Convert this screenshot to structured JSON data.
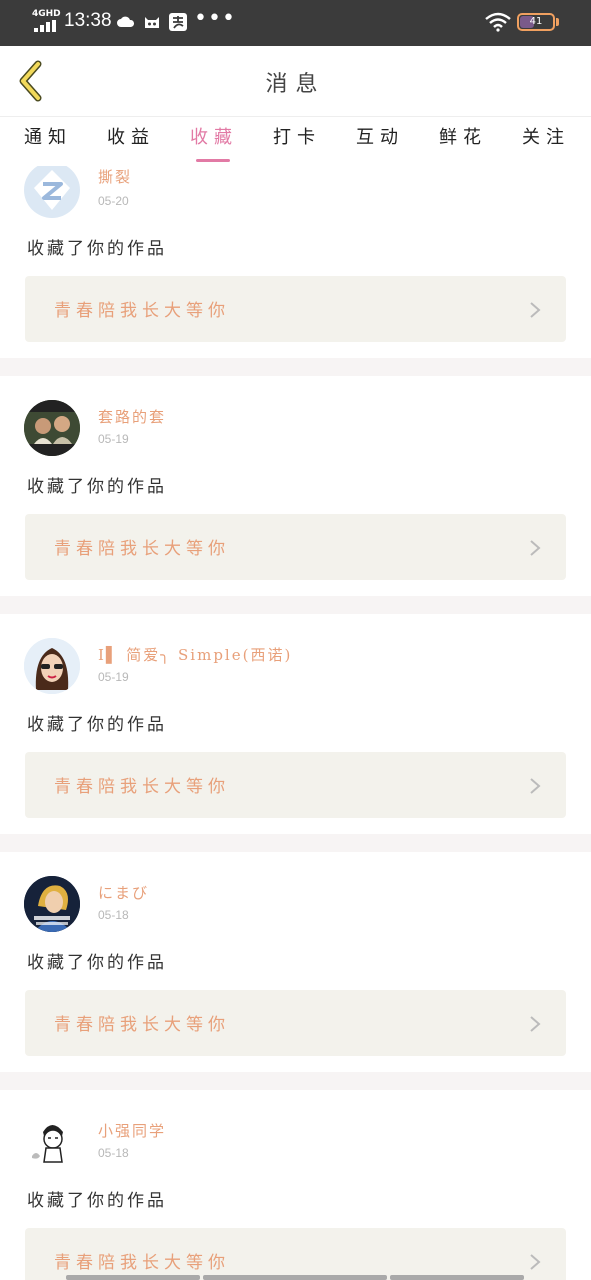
{
  "status_bar": {
    "network": "4GHD",
    "time": "13:38",
    "icons": [
      "cloud-icon",
      "cat-icon",
      "alipay-icon",
      "more-icon"
    ],
    "more": "•••",
    "battery_level": "41"
  },
  "header": {
    "title": "消息",
    "back_icon": "chevron-left-icon"
  },
  "tabs": [
    {
      "label": "通知",
      "active": false
    },
    {
      "label": "收益",
      "active": false
    },
    {
      "label": "收藏",
      "active": true
    },
    {
      "label": "打卡",
      "active": false
    },
    {
      "label": "互动",
      "active": false
    },
    {
      "label": "鲜花",
      "active": false
    },
    {
      "label": "关注",
      "active": false
    }
  ],
  "colors": {
    "accent": "#e27aa5",
    "name": "#e8a07a",
    "work_box_bg": "#f3f2ec"
  },
  "items": [
    {
      "user": "撕裂",
      "date": "05-20",
      "action": "收藏了你的作品",
      "work": "青春陪我长大等你"
    },
    {
      "user": "套路的套",
      "date": "05-19",
      "action": "收藏了你的作品",
      "work": "青春陪我长大等你"
    },
    {
      "user": "I▌ 简爱╮ Simple(西诺)",
      "date": "05-19",
      "action": "收藏了你的作品",
      "work": "青春陪我长大等你"
    },
    {
      "user": "にまび",
      "date": "05-18",
      "action": "收藏了你的作品",
      "work": "青春陪我长大等你"
    },
    {
      "user": "小强同学",
      "date": "05-18",
      "action": "收藏了你的作品",
      "work": "青春陪我长大等你"
    }
  ]
}
